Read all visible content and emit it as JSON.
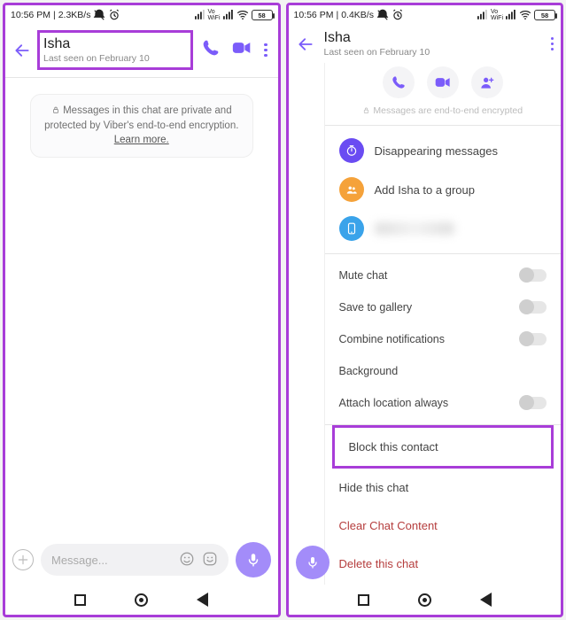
{
  "left": {
    "status": {
      "time": "10:56 PM",
      "speed": "2.3KB/s",
      "battery": "58"
    },
    "header": {
      "name": "Isha",
      "last_seen": "Last seen on February 10"
    },
    "privacy": {
      "prefix": "Messages in this chat are private and protected by Viber's end-to-end encryption. ",
      "learn": "Learn more."
    },
    "composer": {
      "placeholder": "Message..."
    }
  },
  "right": {
    "status": {
      "time": "10:56 PM",
      "speed": "0.4KB/s",
      "battery": "58"
    },
    "header": {
      "name": "Isha",
      "last_seen": "Last seen on February 10"
    },
    "encryption": "Messages are end-to-end encrypted",
    "items": {
      "disappearing": "Disappearing messages",
      "add_group": "Add Isha to a group"
    },
    "settings": {
      "mute": "Mute chat",
      "gallery": "Save to gallery",
      "combine": "Combine notifications",
      "background": "Background",
      "location": "Attach location always"
    },
    "actions": {
      "block": "Block this contact",
      "hide": "Hide this chat",
      "clear": "Clear Chat Content",
      "delete": "Delete this chat"
    }
  }
}
